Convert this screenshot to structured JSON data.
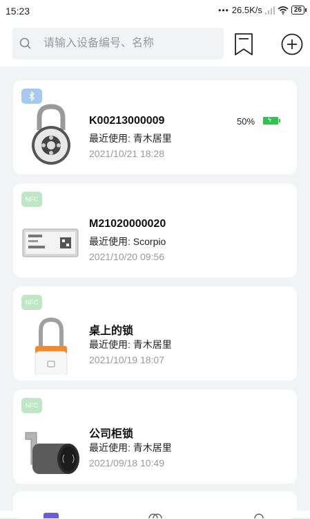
{
  "status_bar": {
    "time": "15:23",
    "network_speed": "26.5K/s",
    "battery_level": "26"
  },
  "search": {
    "placeholder": "请输入设备编号、名称"
  },
  "colors": {
    "bluetooth_tag": "#a8c8ee",
    "nfc_tag": "#bfe6c5",
    "battery_green": "#2fc24f",
    "accent_nav": "#6b5bd6"
  },
  "devices": [
    {
      "tag": "bluetooth",
      "name": "K00213000009",
      "last_use": "最近使用: 青木居里",
      "date": "2021/10/21 18:28",
      "battery": "50%"
    },
    {
      "tag": "NFC",
      "name": "M21020000020",
      "last_use": "最近使用: Scorpio",
      "date": "2021/10/20 09:56"
    },
    {
      "tag": "NFC",
      "name": "桌上的锁",
      "last_use": "最近使用: 青木居里",
      "date": "2021/10/19 18:07"
    },
    {
      "tag": "NFC",
      "name": "公司柜锁",
      "last_use": "最近使用: 青木居里",
      "date": "2021/09/18 10:49"
    }
  ]
}
